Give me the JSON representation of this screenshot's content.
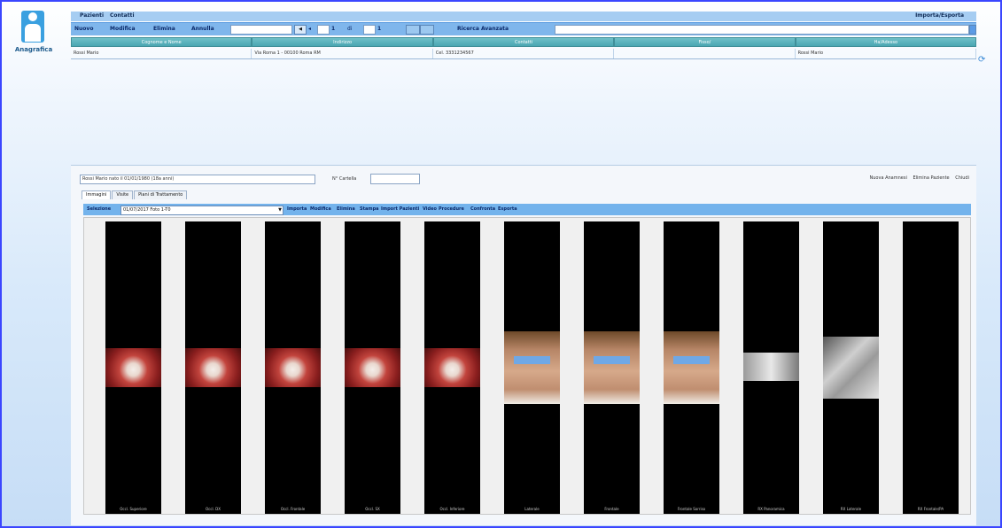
{
  "app": {
    "name": "Anagrafica"
  },
  "topbar": {
    "tabs": [
      "Pazienti",
      "Contatti"
    ],
    "right_link": "Importa/Esporta"
  },
  "toolbar": {
    "nuovo": "Nuovo",
    "modifica": "Modifica",
    "elimina": "Elimina",
    "annulla": "Annulla",
    "page_input": "",
    "page_current": "1",
    "page_of": "di",
    "page_total": "1",
    "recent_label": "Ricerca Avanzata",
    "search_value": ""
  },
  "grid": {
    "headers": [
      "Cognome e Nome",
      "Indirizzo",
      "Contatti",
      "Fisso/",
      "Ha/Adesso"
    ],
    "row": [
      "Rossi Mario",
      "Via Roma 1 - 00100 Roma RM",
      "Cel. 3331234567",
      "",
      "Rossi Mario"
    ]
  },
  "panel": {
    "patient_field": "Rossi Mario nato il 01/01/1980 (18a anni)",
    "cartella_label": "N° Cartella",
    "cartella_value": "",
    "links": [
      "Nuova Anamnesi",
      "Elimina Paziente",
      "Chiudi"
    ],
    "tabs": [
      "Immagini",
      "Visite",
      "Piani di Trattamento"
    ],
    "active_tab": 0
  },
  "image_toolbar": {
    "label": "Selezione",
    "select_value": "01/07/2017 Foto 1-T0",
    "actions": [
      "Importa",
      "Modifica",
      "Elimina",
      "Stampa",
      "Import Pazienti",
      "Video",
      "Procedure",
      "Confronta",
      "Esporta"
    ]
  },
  "photos": [
    {
      "caption": "Occl. Superiore",
      "kind": "intraoral"
    },
    {
      "caption": "Occl. DX",
      "kind": "intraoral"
    },
    {
      "caption": "Occl. Frontale",
      "kind": "intraoral"
    },
    {
      "caption": "Occl. SX",
      "kind": "intraoral"
    },
    {
      "caption": "Occl. Inferiore",
      "kind": "intraoral"
    },
    {
      "caption": "Laterale",
      "kind": "face"
    },
    {
      "caption": "Frontale",
      "kind": "face"
    },
    {
      "caption": "Frontale Sorriso",
      "kind": "face"
    },
    {
      "caption": "RX Panoramica",
      "kind": "xray"
    },
    {
      "caption": "RX Laterale",
      "kind": "xray2"
    },
    {
      "caption": "RX Frontale/PA",
      "kind": "empty"
    }
  ],
  "colors": {
    "frame": "#3b46ff",
    "toolbar": "#7fb6ec",
    "header": "#4aa6b2",
    "accent": "#3aa0e0"
  }
}
